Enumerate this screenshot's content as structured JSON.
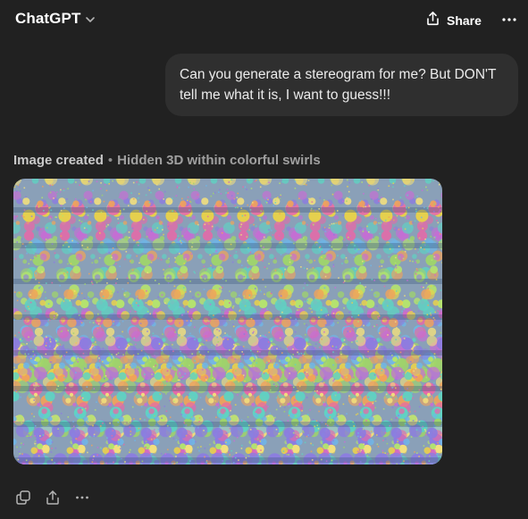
{
  "header": {
    "model_name": "ChatGPT",
    "share_label": "Share"
  },
  "conversation": {
    "user_message": "Can you generate a stereogram for me? But DON'T tell me what it is, I want to guess!!!",
    "image_status": "Image created",
    "image_separator": "•",
    "image_title": "Hidden 3D within colorful swirls"
  },
  "icons": {
    "model_chevron": "chevron-down-icon",
    "share": "share-icon",
    "more_top": "more-horizontal-icon",
    "copy": "copy-icon",
    "share_bottom": "share-icon",
    "more_bottom": "more-horizontal-icon"
  },
  "colors": {
    "background": "#212121",
    "bubble": "#2f2f2f",
    "text": "#ececec",
    "muted": "#b4b4b4"
  }
}
